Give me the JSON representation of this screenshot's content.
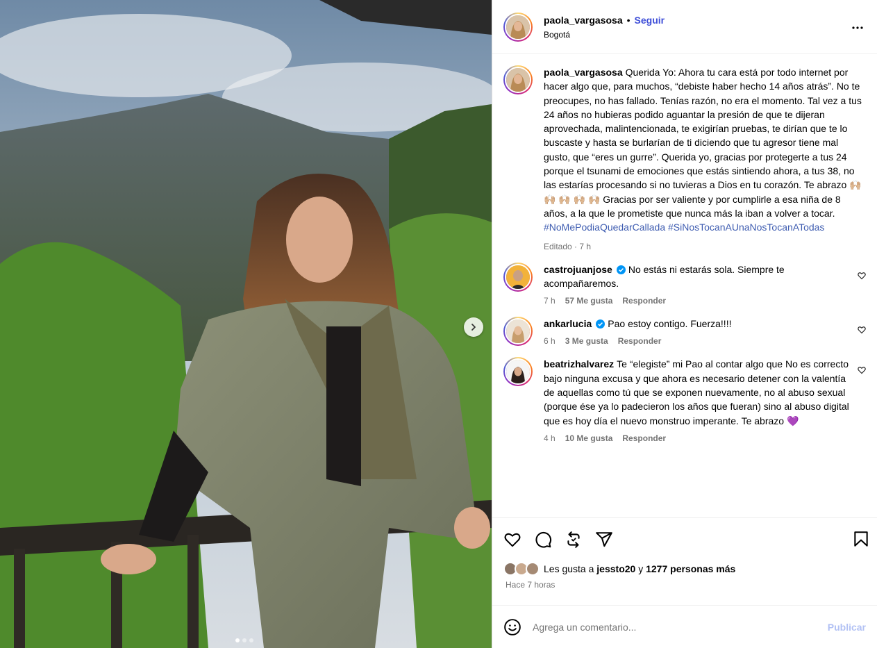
{
  "post": {
    "author": "paola_vargasosa",
    "separator": "•",
    "follow_label": "Seguir",
    "location": "Bogotá",
    "caption": {
      "username": "paola_vargasosa",
      "text": "Querida Yo: Ahora tu cara está por todo internet por hacer algo que, para muchos, “debiste haber hecho 14 años atrás”. No te preocupes, no has fallado. Tenías razón, no era el momento. Tal vez a tus 24 años no hubieras podido aguantar la presión de que te dijeran aprovechada, malintencionada, te exigirían pruebas, te dirían que te lo buscaste y hasta se burlarían de ti diciendo que tu agresor tiene mal gusto, que “eres un gurre”. Querida yo, gracias por protegerte a tus 24 porque el tsunami de emociones que estás sintiendo ahora, a tus 38, no las estarías procesando si no tuvieras a Dios en tu corazón. Te abrazo 🙌🏼 🙌🏼 🙌🏼 🙌🏼 🙌🏼 Gracias por ser valiente y por cumplirle a esa niña de 8 años, a la que le prometiste que nunca más la iban a volver a tocar.",
      "hashtag1": "#NoMePodiaQuedarCallada",
      "hashtag2": "#SiNosTocanAUnaNosTocanATodas",
      "meta": "Editado · 7 h"
    },
    "comments": [
      {
        "username": "castrojuanjose",
        "verified": true,
        "text": "No estás ni estarás sola. Siempre te acompañaremos.",
        "time": "7 h",
        "likes": "57 Me gusta",
        "reply": "Responder"
      },
      {
        "username": "ankarlucia",
        "verified": true,
        "text": "Pao estoy contigo. Fuerza!!!!",
        "time": "6 h",
        "likes": "3 Me gusta",
        "reply": "Responder"
      },
      {
        "username": "beatrizhalvarez",
        "verified": false,
        "text": "Te “elegiste” mi Pao al contar algo que No es correcto bajo ninguna excusa y que ahora es necesario detener con la valentía de aquellas como tú que se exponen nuevamente, no al abuso sexual (porque ése ya lo padecieron los años que fueran) sino al abuso digital que es hoy día el nuevo monstruo imperante. Te abrazo 💜",
        "time": "4 h",
        "likes": "10 Me gusta",
        "reply": "Responder"
      }
    ],
    "likes": {
      "prefix": "Les gusta a",
      "user": "jessto20",
      "conj": "y",
      "others": "1277 personas más"
    },
    "time_ago": "Hace 7 horas",
    "comment_input": {
      "placeholder": "Agrega un comentario...",
      "publish_label": "Publicar"
    }
  },
  "carousel": {
    "current": 1,
    "total": 3
  },
  "icons": {
    "more": "more-horizontal-icon",
    "next": "chevron-right-icon",
    "like": "heart-icon",
    "comment": "comment-bubble-icon",
    "share": "repost-icon",
    "send": "send-icon",
    "save": "bookmark-icon",
    "verified": "verified-badge-icon",
    "emoji": "emoji-smile-icon"
  },
  "colors": {
    "follow": "#3f4fd8",
    "hashtag": "#3f5db1",
    "verified": "#0095f6",
    "muted": "#737373",
    "publish_disabled": "#b2c1f4"
  }
}
